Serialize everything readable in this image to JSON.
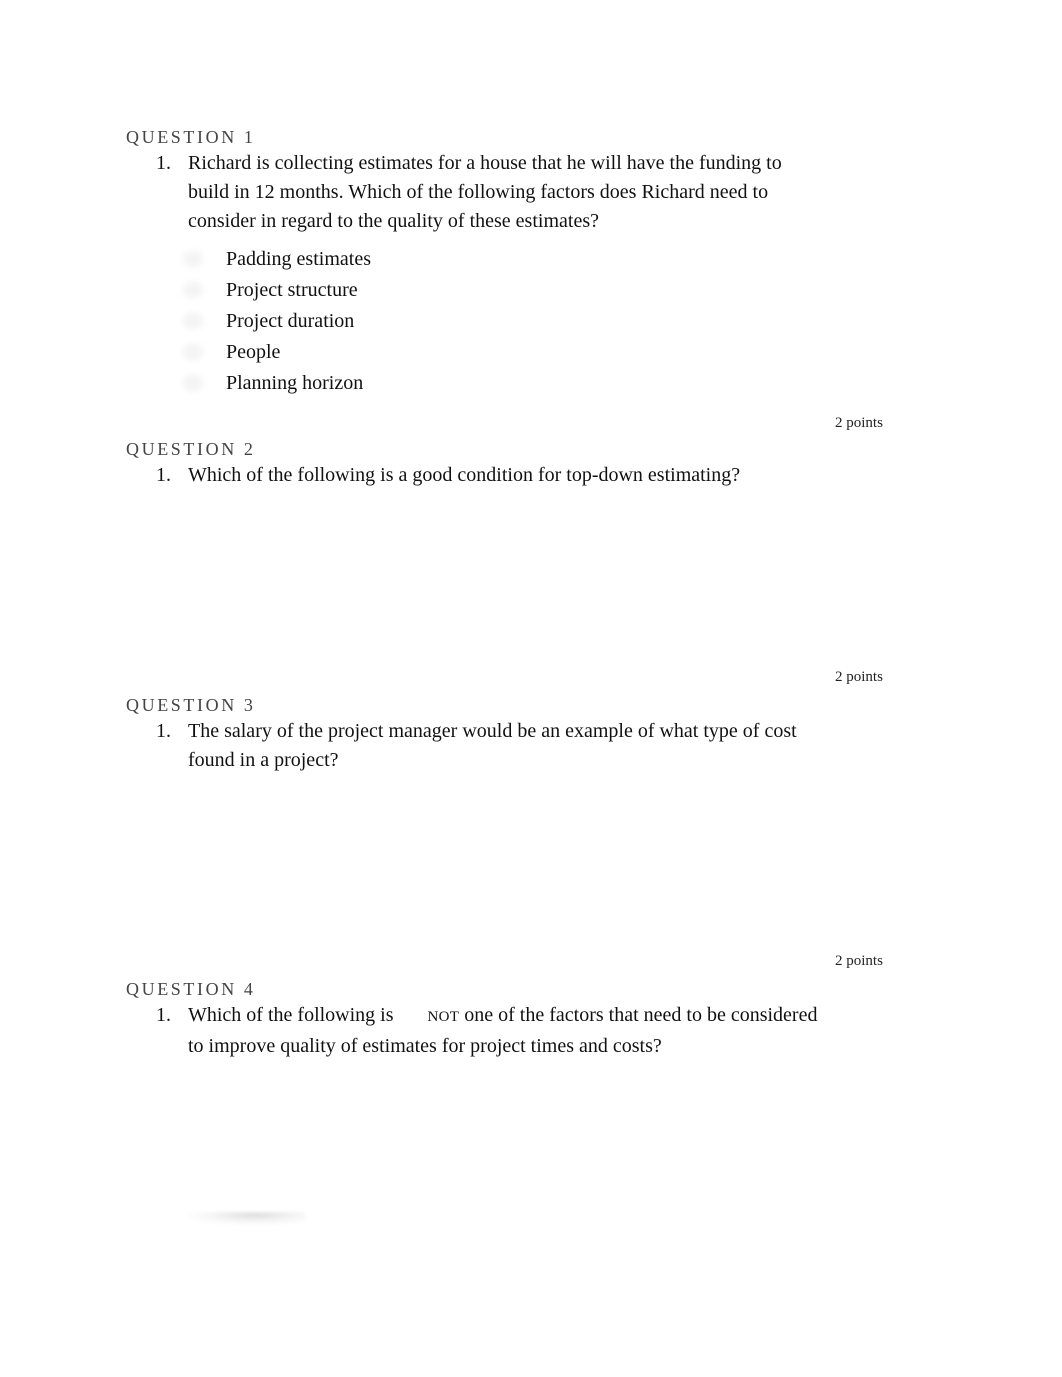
{
  "questions": [
    {
      "heading": "QUESTION 1",
      "number": "1.",
      "lines": [
        "Richard is collecting estimates for a house that he will have the funding to",
        "build in 12 months. Which of the following factors does Richard need to",
        "consider in regard to the quality of these estimates?"
      ],
      "options": [
        "Padding estimates",
        "Project structure",
        "Project duration",
        "People",
        "Planning horizon"
      ],
      "points": "2 points"
    },
    {
      "heading": "QUESTION 2",
      "number": "1.",
      "lines": [
        "Which of the following is a good condition for top-down estimating?"
      ],
      "points": "2 points"
    },
    {
      "heading": "QUESTION 3",
      "number": "1.",
      "lines": [
        "The salary of the project manager would be an example of what type of cost",
        "found in a project?"
      ],
      "points": "2 points"
    },
    {
      "heading": "QUESTION 4",
      "number": "1.",
      "line1_before": "Which of the following is",
      "line1_emphasis": "NOT",
      "line1_after": " one of the factors that need to be considered",
      "line2": "to improve quality of estimates for project times and costs?"
    }
  ]
}
